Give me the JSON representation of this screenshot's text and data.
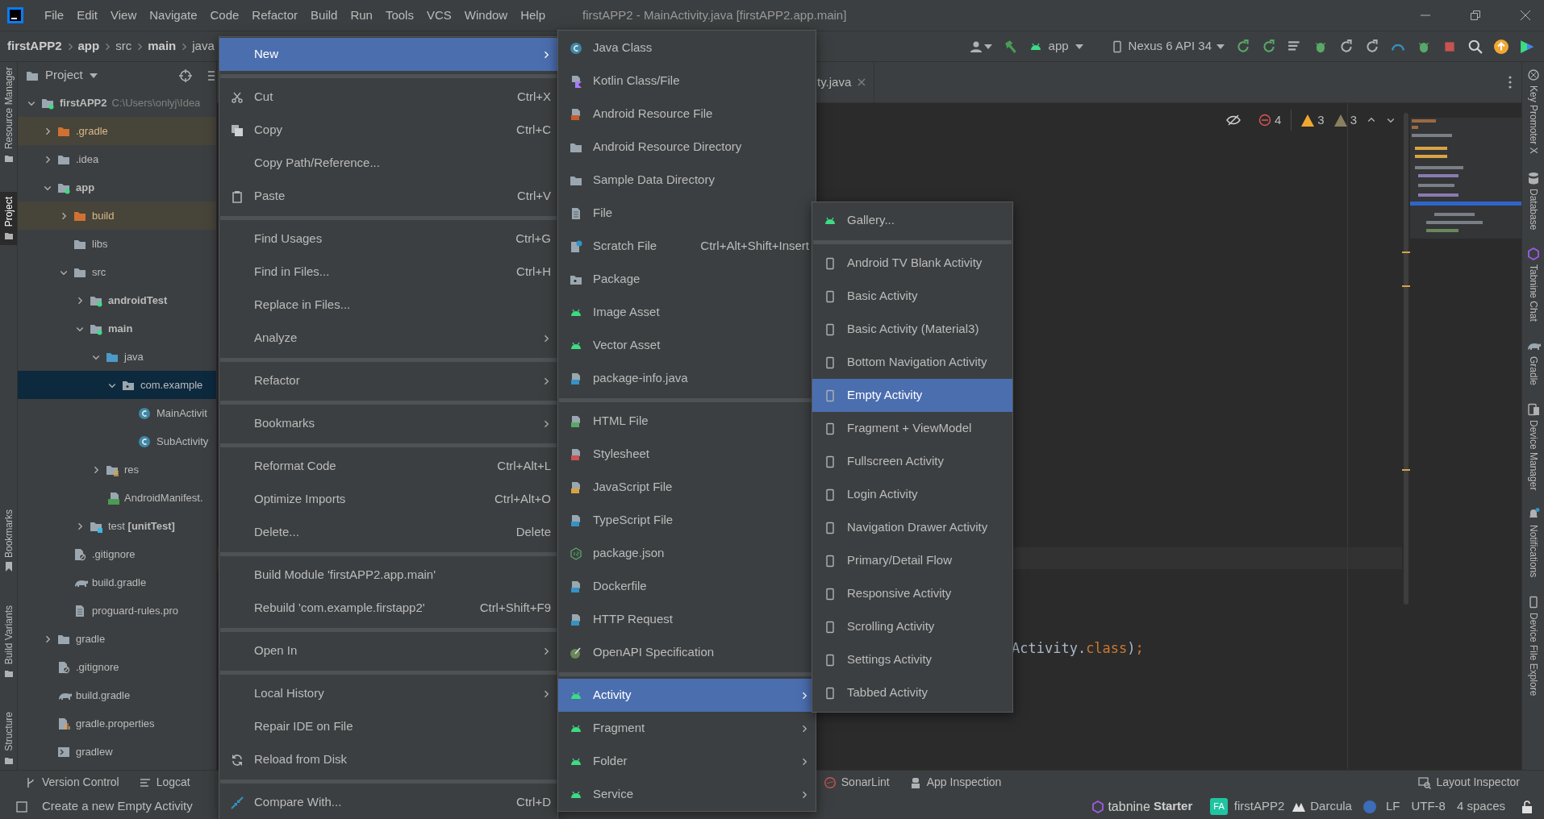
{
  "window": {
    "title": "firstAPP2 - MainActivity.java [firstAPP2.app.main]",
    "menu": [
      "File",
      "Edit",
      "View",
      "Navigate",
      "Code",
      "Refactor",
      "Build",
      "Run",
      "Tools",
      "VCS",
      "Window",
      "Help"
    ]
  },
  "breadcrumb": [
    {
      "label": "firstAPP2",
      "bold": true
    },
    {
      "label": "app",
      "bold": true
    },
    {
      "label": "src",
      "bold": false
    },
    {
      "label": "main",
      "bold": true
    },
    {
      "label": "java",
      "bold": false
    }
  ],
  "toolbar": {
    "run_config": "app",
    "device": "Nexus 6 API 34"
  },
  "left_tool_windows": {
    "top": [
      {
        "label": "Resource Manager",
        "selected": false
      },
      {
        "label": "Project",
        "selected": true
      }
    ],
    "bottom": [
      {
        "label": "Bookmarks",
        "selected": false
      },
      {
        "label": "Build Variants",
        "selected": false
      },
      {
        "label": "Structure",
        "selected": false
      }
    ]
  },
  "project_panel": {
    "title": "Project",
    "tree": [
      {
        "label": "firstAPP2",
        "hint": "C:\\Users\\onlyj\\Idea",
        "kind": "module",
        "bold": true,
        "expanded": true,
        "selected": false,
        "excluded": false,
        "children": [
          {
            "label": ".gradle",
            "kind": "folder",
            "bold": false,
            "expanded": false,
            "selected": false,
            "excluded": true
          },
          {
            "label": ".idea",
            "kind": "folder",
            "bold": false,
            "expanded": false,
            "selected": false,
            "excluded": false
          },
          {
            "label": "app",
            "kind": "module",
            "bold": true,
            "expanded": true,
            "selected": false,
            "excluded": false,
            "children": [
              {
                "label": "build",
                "kind": "folder",
                "bold": false,
                "expanded": false,
                "selected": false,
                "excluded": true
              },
              {
                "label": "libs",
                "kind": "folder",
                "bold": false,
                "selected": false,
                "excluded": false
              },
              {
                "label": "src",
                "kind": "folder",
                "bold": false,
                "expanded": true,
                "selected": false,
                "excluded": false,
                "children": [
                  {
                    "label": "androidTest",
                    "kind": "module",
                    "bold": true,
                    "expanded": false,
                    "selected": false,
                    "excluded": false
                  },
                  {
                    "label": "main",
                    "kind": "module",
                    "bold": true,
                    "expanded": true,
                    "selected": false,
                    "excluded": false,
                    "children": [
                      {
                        "label": "java",
                        "kind": "source",
                        "bold": false,
                        "expanded": true,
                        "selected": false,
                        "excluded": false,
                        "children": [
                          {
                            "label": "com.example",
                            "kind": "package",
                            "bold": false,
                            "expanded": true,
                            "selected": true,
                            "excluded": false,
                            "children": [
                              {
                                "label": "MainActivit",
                                "kind": "class",
                                "bold": false,
                                "selected": false,
                                "excluded": false
                              },
                              {
                                "label": "SubActivity",
                                "kind": "class",
                                "bold": false,
                                "selected": false,
                                "excluded": false
                              }
                            ]
                          }
                        ]
                      },
                      {
                        "label": "res",
                        "kind": "res",
                        "bold": false,
                        "expanded": false,
                        "selected": false,
                        "excluded": false
                      },
                      {
                        "label": "AndroidManifest.",
                        "kind": "manifest",
                        "bold": false,
                        "selected": false,
                        "excluded": false
                      }
                    ]
                  },
                  {
                    "label": "test **[unitTest]**",
                    "kind": "test",
                    "bold": false,
                    "expanded": false,
                    "selected": false,
                    "excluded": false
                  }
                ]
              },
              {
                "label": ".gitignore",
                "kind": "ignore",
                "bold": false,
                "selected": false,
                "excluded": false
              },
              {
                "label": "build.gradle",
                "kind": "gradle",
                "bold": false,
                "selected": false,
                "excluded": false
              },
              {
                "label": "proguard-rules.pro",
                "kind": "file",
                "bold": false,
                "selected": false,
                "excluded": false
              }
            ]
          },
          {
            "label": "gradle",
            "kind": "folder",
            "bold": false,
            "expanded": false,
            "selected": false,
            "excluded": false
          },
          {
            "label": ".gitignore",
            "kind": "ignore",
            "bold": false,
            "selected": false,
            "excluded": false
          },
          {
            "label": "build.gradle",
            "kind": "gradle",
            "bold": false,
            "selected": false,
            "excluded": false
          },
          {
            "label": "gradle.properties",
            "kind": "properties",
            "bold": false,
            "selected": false,
            "excluded": false
          },
          {
            "label": "gradlew",
            "kind": "terminal",
            "bold": false,
            "selected": false,
            "excluded": false
          }
        ]
      }
    ]
  },
  "context_menu": [
    {
      "kind": "plain",
      "label": "New",
      "selected": true,
      "submenu": true
    },
    {
      "kind": "separator"
    },
    {
      "kind": "scissors",
      "label": "Cut",
      "shortcut": "Ctrl+X",
      "selected": false,
      "submenu": false
    },
    {
      "kind": "copy",
      "label": "Copy",
      "shortcut": "Ctrl+C",
      "selected": false,
      "submenu": false
    },
    {
      "kind": "plain",
      "label": "Copy Path/Reference...",
      "selected": false,
      "submenu": false
    },
    {
      "kind": "paste",
      "label": "Paste",
      "shortcut": "Ctrl+V",
      "selected": false,
      "submenu": false
    },
    {
      "kind": "separator"
    },
    {
      "kind": "plain",
      "label": "Find Usages",
      "shortcut": "Ctrl+G",
      "selected": false,
      "submenu": false
    },
    {
      "kind": "plain",
      "label": "Find in Files...",
      "shortcut": "Ctrl+H",
      "selected": false,
      "submenu": false
    },
    {
      "kind": "plain",
      "label": "Replace in Files...",
      "selected": false,
      "submenu": false
    },
    {
      "kind": "plain",
      "label": "Analyze",
      "selected": false,
      "submenu": true
    },
    {
      "kind": "separator"
    },
    {
      "kind": "plain",
      "label": "Refactor",
      "selected": false,
      "submenu": true
    },
    {
      "kind": "separator"
    },
    {
      "kind": "plain",
      "label": "Bookmarks",
      "selected": false,
      "submenu": true
    },
    {
      "kind": "separator"
    },
    {
      "kind": "plain",
      "label": "Reformat Code",
      "shortcut": "Ctrl+Alt+L",
      "selected": false,
      "submenu": false
    },
    {
      "kind": "plain",
      "label": "Optimize Imports",
      "shortcut": "Ctrl+Alt+O",
      "selected": false,
      "submenu": false
    },
    {
      "kind": "plain",
      "label": "Delete...",
      "shortcut": "Delete",
      "selected": false,
      "submenu": false
    },
    {
      "kind": "separator"
    },
    {
      "kind": "plain",
      "label": "Build Module 'firstAPP2.app.main'",
      "selected": false,
      "submenu": false
    },
    {
      "kind": "plain",
      "label": "Rebuild 'com.example.firstapp2'",
      "shortcut": "Ctrl+Shift+F9",
      "selected": false,
      "submenu": false
    },
    {
      "kind": "separator"
    },
    {
      "kind": "plain",
      "label": "Open In",
      "selected": false,
      "submenu": true
    },
    {
      "kind": "separator"
    },
    {
      "kind": "plain",
      "label": "Local History",
      "selected": false,
      "submenu": true
    },
    {
      "kind": "plain",
      "label": "Repair IDE on File",
      "selected": false,
      "submenu": false
    },
    {
      "kind": "reload",
      "label": "Reload from Disk",
      "selected": false,
      "submenu": false
    },
    {
      "kind": "separator"
    },
    {
      "kind": "compare",
      "label": "Compare With...",
      "shortcut": "Ctrl+D",
      "selected": false,
      "submenu": false
    }
  ],
  "new_submenu": [
    {
      "kind": "class",
      "label": "Java Class",
      "selected": false,
      "submenu": false
    },
    {
      "kind": "kotlin",
      "label": "Kotlin Class/File",
      "selected": false,
      "submenu": false
    },
    {
      "kind": "resfile",
      "label": "Android Resource File",
      "selected": false,
      "submenu": false
    },
    {
      "kind": "folder",
      "label": "Android Resource Directory",
      "selected": false,
      "submenu": false
    },
    {
      "kind": "folder",
      "label": "Sample Data Directory",
      "selected": false,
      "submenu": false
    },
    {
      "kind": "file",
      "label": "File",
      "selected": false,
      "submenu": false
    },
    {
      "kind": "scratch",
      "label": "Scratch File",
      "shortcut": "Ctrl+Alt+Shift+Insert",
      "selected": false,
      "submenu": false
    },
    {
      "kind": "package",
      "label": "Package",
      "selected": false,
      "submenu": false
    },
    {
      "kind": "android",
      "label": "Image Asset",
      "selected": false,
      "submenu": false
    },
    {
      "kind": "android",
      "label": "Vector Asset",
      "selected": false,
      "submenu": false
    },
    {
      "kind": "javafile",
      "label": "package-info.java",
      "selected": false,
      "submenu": false
    },
    {
      "kind": "separator"
    },
    {
      "kind": "html",
      "label": "HTML File",
      "selected": false,
      "submenu": false
    },
    {
      "kind": "css",
      "label": "Stylesheet",
      "selected": false,
      "submenu": false
    },
    {
      "kind": "js",
      "label": "JavaScript File",
      "selected": false,
      "submenu": false
    },
    {
      "kind": "ts",
      "label": "TypeScript File",
      "selected": false,
      "submenu": false
    },
    {
      "kind": "node",
      "label": "package.json",
      "selected": false,
      "submenu": false
    },
    {
      "kind": "docker",
      "label": "Dockerfile",
      "selected": false,
      "submenu": false
    },
    {
      "kind": "api",
      "label": "HTTP Request",
      "selected": false,
      "submenu": false
    },
    {
      "kind": "openapi",
      "label": "OpenAPI Specification",
      "selected": false,
      "submenu": false
    },
    {
      "kind": "separator"
    },
    {
      "kind": "android",
      "label": "Activity",
      "selected": true,
      "submenu": true
    },
    {
      "kind": "android",
      "label": "Fragment",
      "selected": false,
      "submenu": true
    },
    {
      "kind": "android",
      "label": "Folder",
      "selected": false,
      "submenu": true
    },
    {
      "kind": "android",
      "label": "Service",
      "selected": false,
      "submenu": true
    }
  ],
  "activity_submenu": [
    {
      "kind": "android",
      "label": "Gallery...",
      "selected": false,
      "submenu": false
    },
    {
      "kind": "separator"
    },
    {
      "kind": "phone",
      "label": "Android TV Blank Activity",
      "selected": false,
      "submenu": false
    },
    {
      "kind": "phone",
      "label": "Basic Activity",
      "selected": false,
      "submenu": false
    },
    {
      "kind": "phone",
      "label": "Basic Activity (Material3)",
      "selected": false,
      "submenu": false
    },
    {
      "kind": "phone",
      "label": "Bottom Navigation Activity",
      "selected": false,
      "submenu": false
    },
    {
      "kind": "phone",
      "label": "Empty Activity",
      "selected": true,
      "submenu": false
    },
    {
      "kind": "phone",
      "label": "Fragment + ViewModel",
      "selected": false,
      "submenu": false
    },
    {
      "kind": "phone",
      "label": "Fullscreen Activity",
      "selected": false,
      "submenu": false
    },
    {
      "kind": "phone",
      "label": "Login Activity",
      "selected": false,
      "submenu": false
    },
    {
      "kind": "phone",
      "label": "Navigation Drawer Activity",
      "selected": false,
      "submenu": false
    },
    {
      "kind": "phone",
      "label": "Primary/Detail Flow",
      "selected": false,
      "submenu": false
    },
    {
      "kind": "phone",
      "label": "Responsive Activity",
      "selected": false,
      "submenu": false
    },
    {
      "kind": "phone",
      "label": "Scrolling Activity",
      "selected": false,
      "submenu": false
    },
    {
      "kind": "phone",
      "label": "Settings Activity",
      "selected": false,
      "submenu": false
    },
    {
      "kind": "phone",
      "label": "Tabbed Activity",
      "selected": false,
      "submenu": false
    }
  ],
  "editor": {
    "tab": "ty.java",
    "inspections": {
      "errors": "4",
      "warnings": "3",
      "weak_warnings": "3"
    },
    "code": [
      {
        "text": "Activity.",
        "kind": "plain"
      },
      {
        "text": "class",
        "kind": "keyword"
      },
      {
        "text": ")",
        "kind": "plain"
      },
      {
        "text": ";",
        "kind": "keyword"
      }
    ]
  },
  "right_tool_windows": [
    "Key Promoter X",
    "Database",
    "Tabnine Chat",
    "Gradle",
    "Device Manager",
    "Notifications",
    "Device File Explore"
  ],
  "bottom_tool_windows": {
    "left": [
      "Version Control",
      "Logcat"
    ],
    "middle": [
      "SonarLint",
      "App Inspection"
    ],
    "right": [
      "Layout Inspector"
    ]
  },
  "status_bar": {
    "message": "Create a new Empty Activity",
    "tabnine_logo": "tabnine",
    "tabnine_plan": "Starter",
    "project_badge": "FA",
    "project": "firstAPP2",
    "theme": "Darcula",
    "line_separator": "LF",
    "encoding": "UTF-8",
    "indent": "4 spaces"
  }
}
